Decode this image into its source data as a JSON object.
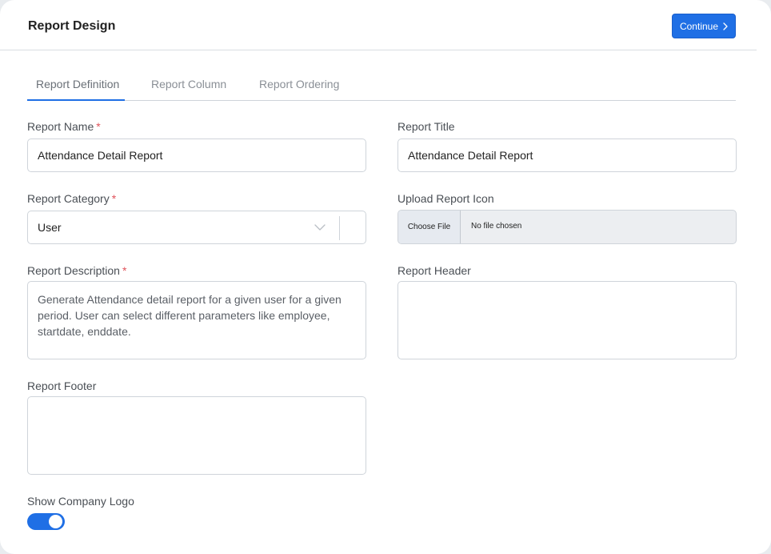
{
  "header": {
    "title": "Report Design",
    "continue_label": "Continue",
    "accent_color": "#1f6fe5"
  },
  "tabs": [
    {
      "label": "Report Definition",
      "active": true
    },
    {
      "label": "Report Column",
      "active": false
    },
    {
      "label": "Report Ordering",
      "active": false
    }
  ],
  "form": {
    "report_name": {
      "label": "Report Name",
      "required_mark": "*",
      "value": "Attendance Detail Report"
    },
    "report_title": {
      "label": "Report Title",
      "value": "Attendance Detail Report"
    },
    "report_category": {
      "label": "Report Category",
      "required_mark": "*",
      "value": "User",
      "icon": "chevron-down-icon"
    },
    "upload_icon": {
      "label": "Upload Report Icon",
      "button_label": "Choose File",
      "status": "No file chosen"
    },
    "report_description": {
      "label": "Report Description",
      "required_mark": "*",
      "value": "Generate Attendance detail report for a given user for a given period. User can select different parameters like employee, startdate, enddate."
    },
    "report_header": {
      "label": "Report Header",
      "value": ""
    },
    "report_footer": {
      "label": "Report Footer",
      "value": ""
    },
    "show_company_logo": {
      "label": "Show Company Logo",
      "enabled": true
    }
  }
}
